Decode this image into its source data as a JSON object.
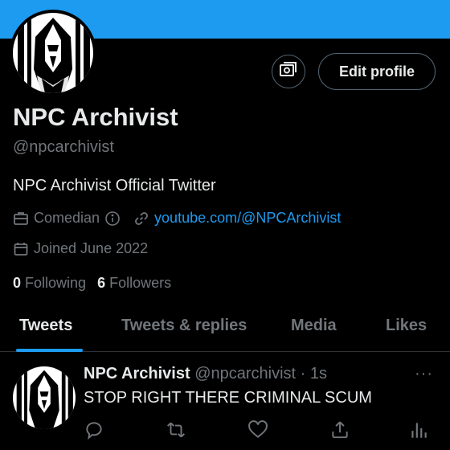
{
  "profile": {
    "display_name": "NPC Archivist",
    "handle": "@npcarchivist",
    "bio": "NPC Archivist Official Twitter",
    "category": "Comedian",
    "link": "youtube.com/@NPCArchivist",
    "joined": "Joined June 2022",
    "following_count": "0",
    "following_label": "Following",
    "followers_count": "6",
    "followers_label": "Followers",
    "edit_button_label": "Edit profile"
  },
  "tabs": [
    {
      "label": "Tweets",
      "active": true
    },
    {
      "label": "Tweets & replies",
      "active": false
    },
    {
      "label": "Media",
      "active": false
    },
    {
      "label": "Likes",
      "active": false
    }
  ],
  "tweet": {
    "author_name": "NPC Archivist",
    "author_handle": "@npcarchivist",
    "time": "· 1s",
    "text": "STOP RIGHT THERE CRIMINAL SCUM",
    "more_label": "···"
  },
  "icons": {
    "media": "media-icon",
    "category": "briefcase-icon",
    "info": "info-icon",
    "link": "link-icon",
    "joined": "calendar-icon",
    "reply": "reply-icon",
    "retweet": "retweet-icon",
    "like": "like-icon",
    "share": "share-icon",
    "analytics": "analytics-icon"
  },
  "colors": {
    "accent": "#1d9bf0",
    "background": "#000000",
    "text_primary": "#e7e9ea",
    "text_secondary": "#71767b"
  }
}
